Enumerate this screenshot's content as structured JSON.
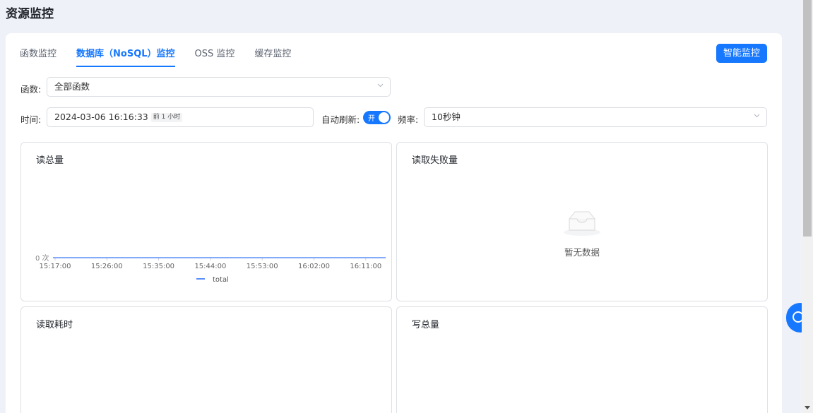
{
  "page": {
    "title": "资源监控"
  },
  "tabs": [
    {
      "label": "函数监控",
      "active": false
    },
    {
      "label": "数据库（NoSQL）监控",
      "active": true
    },
    {
      "label": "OSS 监控",
      "active": false
    },
    {
      "label": "缓存监控",
      "active": false
    }
  ],
  "smart_button": {
    "label": "智能监控"
  },
  "filters": {
    "function_label": "函数:",
    "function_value": "全部函数",
    "time_label": "时间:",
    "time_value": "2024-03-06 16:16:33",
    "time_tag": "前 1 小时",
    "auto_refresh_label": "自动刷新:",
    "auto_refresh_state": "开",
    "frequency_label": "频率:",
    "frequency_value": "10秒钟"
  },
  "panels": {
    "read_total": {
      "title": "读总量"
    },
    "read_fail": {
      "title": "读取失败量",
      "empty_text": "暂无数据"
    },
    "read_latency": {
      "title": "读取耗时"
    },
    "write_total": {
      "title": "写总量"
    }
  },
  "colors": {
    "accent": "#1677ff",
    "series": "#5b8ff9"
  },
  "chart_data": {
    "type": "line",
    "title": "读总量",
    "x": [
      "15:17:00",
      "15:26:00",
      "15:35:00",
      "15:44:00",
      "15:53:00",
      "16:02:00",
      "16:11:00"
    ],
    "series": [
      {
        "name": "total",
        "values": [
          0,
          0,
          0,
          0,
          0,
          0,
          0
        ]
      }
    ],
    "y_tick_labels": [
      "0 次"
    ],
    "ylim": [
      0,
      0
    ],
    "legend": "bottom-center"
  }
}
